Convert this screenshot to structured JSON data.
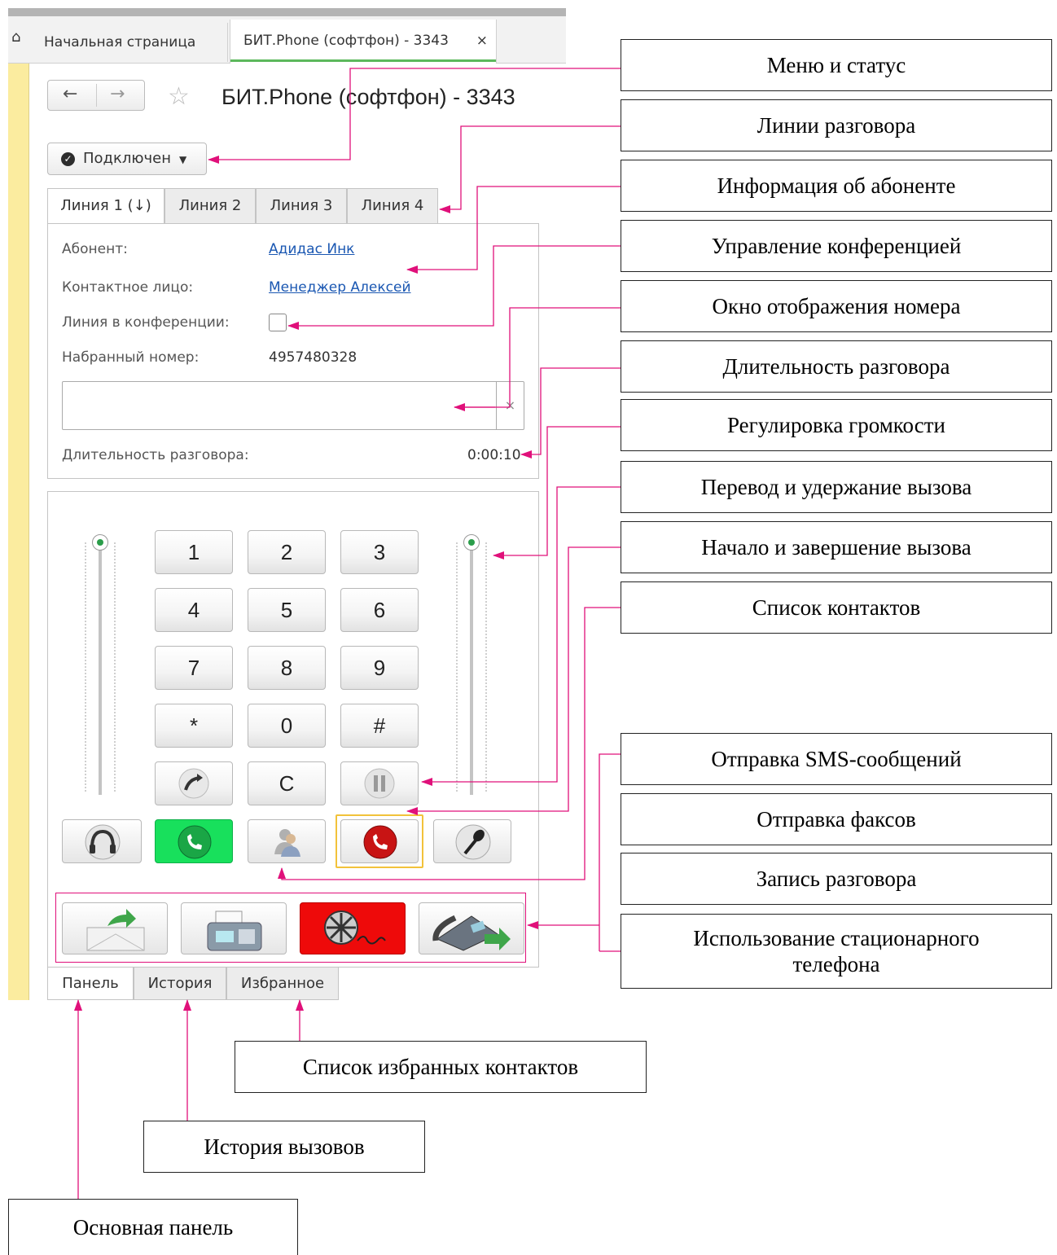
{
  "tabs": {
    "home_label": "Начальная страница",
    "active_label": "БИТ.Phone (софтфон) - 3343",
    "close_symbol": "×"
  },
  "page": {
    "title": "БИТ.Phone (софтфон) - 3343"
  },
  "status_menu": {
    "label": "Подключен"
  },
  "line_tabs": [
    "Линия 1 (↓)",
    "Линия 2",
    "Линия 3",
    "Линия 4"
  ],
  "info": {
    "subscriber_label": "Абонент:",
    "subscriber_value": "Адидас Инк",
    "contact_label": "Контактное лицо:",
    "contact_value": "Менеджер Алексей",
    "conference_label": "Линия в конференции:",
    "dialed_label": "Набранный номер:",
    "dialed_value": "4957480328",
    "duration_label": "Длительность разговора:",
    "duration_value": "0:00:10"
  },
  "keypad": [
    "1",
    "2",
    "3",
    "4",
    "5",
    "6",
    "7",
    "8",
    "9",
    "*",
    "0",
    "#"
  ],
  "keypad_c": "C",
  "bottom_tabs": [
    "Панель",
    "История",
    "Избранное"
  ],
  "annotations": {
    "menu_status": "Меню и статус",
    "lines": "Линии разговора",
    "subscriber_info": "Информация об абоненте",
    "conference": "Управление конференцией",
    "number_window": "Окно отображения номера",
    "duration": "Длительность разговора",
    "volume": "Регулировка громкости",
    "transfer_hold": "Перевод и удержание вызова",
    "start_end_call": "Начало и завершение вызова",
    "contacts_list": "Список контактов",
    "sms": "Отправка SMS-сообщений",
    "fax": "Отправка факсов",
    "record": "Запись разговора",
    "landline": "Использование стационарного телефона",
    "favorites": "Список избранных контактов",
    "history": "История вызовов",
    "main_panel": "Основная панель"
  },
  "colors": {
    "accent_green": "#5cb85c",
    "call_green": "#18e05c",
    "record_red": "#ee0a0a",
    "annotation_magenta": "#e0107a",
    "left_strip": "#fbec9f",
    "link": "#1a57b2"
  }
}
